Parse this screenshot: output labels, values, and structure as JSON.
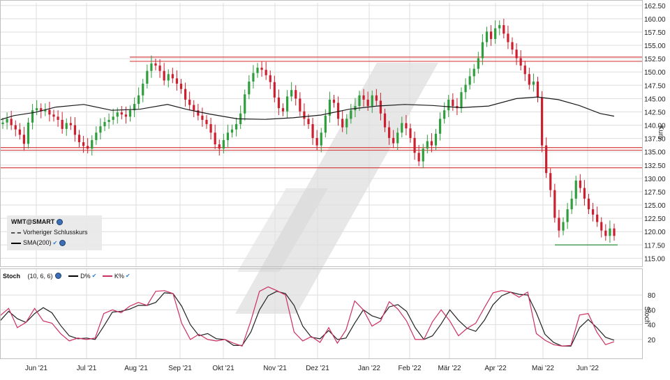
{
  "chart_data": [
    {
      "type": "candlestick",
      "title": "WMT@SMART",
      "ylabel": "Kurs",
      "ylim": [
        114,
        163
      ],
      "yticks": [
        "115.00",
        "117.50",
        "120.00",
        "122.50",
        "125.00",
        "127.50",
        "130.00",
        "132.50",
        "135.00",
        "137.50",
        "140.00",
        "142.50",
        "145.00",
        "147.50",
        "150.00",
        "152.50",
        "155.00",
        "157.50",
        "160.00",
        "162.50"
      ],
      "xticks": [
        "Jun '21",
        "Jul '21",
        "Aug '21",
        "Sep '21",
        "Okt '21",
        "Nov '21",
        "Dez '21",
        "Jan '22",
        "Feb '22",
        "Mär '22",
        "Apr '22",
        "Mai '22",
        "Jun '22"
      ],
      "legend": [
        {
          "label": "Vorheriger Schlusskurs",
          "style": "dashed"
        },
        {
          "label": "SMA(200)",
          "style": "solid"
        }
      ],
      "horizontal_levels": [
        {
          "value": 152.8,
          "color": "#d64545"
        },
        {
          "value": 152.0,
          "color": "#d64545"
        },
        {
          "value": 135.8,
          "color": "#d64545"
        },
        {
          "value": 135.3,
          "color": "#d64545"
        },
        {
          "value": 132.0,
          "color": "#d64545"
        },
        {
          "value": 117.5,
          "color": "#2e8b3e"
        }
      ],
      "close_series": [
        140.5,
        141.2,
        140.0,
        139.2,
        138.2,
        136.5,
        140.5,
        142.8,
        143.2,
        142.6,
        142.9,
        142.0,
        141.6,
        141.0,
        139.3,
        140.4,
        140.0,
        138.2,
        136.8,
        136.1,
        135.6,
        137.2,
        138.6,
        139.8,
        140.6,
        141.0,
        141.6,
        142.4,
        142.0,
        141.6,
        142.8,
        144.0,
        145.6,
        147.8,
        150.2,
        151.6,
        151.2,
        150.2,
        148.4,
        149.6,
        148.8,
        147.8,
        146.8,
        144.8,
        143.8,
        142.8,
        141.8,
        141.0,
        140.2,
        138.6,
        136.4,
        135.6,
        137.2,
        138.6,
        139.2,
        140.2,
        142.2,
        145.8,
        148.2,
        149.8,
        150.8,
        150.4,
        149.4,
        148.1,
        145.2,
        143.2,
        142.6,
        145.4,
        146.6,
        145.0,
        142.6,
        141.2,
        140.2,
        137.6,
        136.2,
        138.6,
        141.8,
        144.8,
        144.2,
        141.2,
        139.6,
        141.2,
        142.8,
        143.6,
        145.6,
        144.8,
        143.6,
        145.6,
        144.6,
        142.2,
        139.6,
        137.6,
        136.6,
        138.6,
        140.4,
        139.4,
        137.6,
        134.8,
        133.2,
        135.6,
        137.0,
        136.2,
        138.4,
        141.2,
        142.8,
        144.8,
        143.6,
        143.2,
        146.2,
        147.6,
        149.2,
        150.6,
        152.6,
        155.6,
        157.6,
        156.2,
        158.2,
        158.8,
        157.2,
        155.6,
        154.2,
        152.6,
        151.2,
        149.6,
        147.6,
        148.2,
        145.2,
        136.2,
        131.0,
        127.8,
        122.6,
        120.2,
        121.8,
        124.2,
        126.2,
        129.6,
        128.2,
        126.2,
        124.2,
        123.2,
        121.8,
        120.2,
        119.2,
        120.6,
        119.2
      ],
      "sma200": [
        [
          0,
          141.0
        ],
        [
          20,
          141.8
        ],
        [
          50,
          142.4
        ],
        [
          80,
          143.4
        ],
        [
          120,
          143.9
        ],
        [
          160,
          142.8
        ],
        [
          200,
          143.0
        ],
        [
          240,
          143.9
        ],
        [
          270,
          142.9
        ],
        [
          300,
          142.1
        ],
        [
          340,
          141.2
        ],
        [
          380,
          141.1
        ],
        [
          420,
          141.4
        ],
        [
          460,
          141.9
        ],
        [
          500,
          143.0
        ],
        [
          540,
          143.6
        ],
        [
          580,
          143.9
        ],
        [
          620,
          143.7
        ],
        [
          660,
          143.3
        ],
        [
          700,
          143.6
        ],
        [
          740,
          145.0
        ],
        [
          770,
          145.3
        ],
        [
          800,
          144.8
        ],
        [
          830,
          143.7
        ],
        [
          860,
          142.2
        ],
        [
          880,
          141.7
        ]
      ]
    },
    {
      "type": "line",
      "title": "Stoch",
      "params": "(10, 6, 6)",
      "ylabel": "Stoch",
      "ylim": [
        2,
        98
      ],
      "yticks": [
        "20",
        "40",
        "60",
        "80"
      ],
      "series": [
        {
          "name": "D%",
          "color": "#222222",
          "values": [
            45,
            58,
            48,
            43,
            55,
            63,
            56,
            39,
            25,
            21,
            22,
            20,
            38,
            57,
            58,
            61,
            66,
            66,
            70,
            83,
            82,
            65,
            40,
            25,
            28,
            21,
            20,
            12,
            12,
            30,
            60,
            79,
            85,
            82,
            66,
            38,
            23,
            21,
            32,
            20,
            22,
            42,
            60,
            52,
            48,
            64,
            67,
            58,
            36,
            20,
            25,
            41,
            60,
            46,
            35,
            31,
            46,
            67,
            79,
            84,
            81,
            80,
            56,
            27,
            16,
            11,
            11,
            36,
            47,
            36,
            23,
            19
          ]
        },
        {
          "name": "K%",
          "color": "#cc3060",
          "values": [
            52,
            62,
            36,
            43,
            62,
            45,
            42,
            28,
            18,
            22,
            20,
            22,
            55,
            60,
            56,
            65,
            70,
            66,
            85,
            86,
            82,
            42,
            20,
            27,
            20,
            18,
            20,
            15,
            11,
            45,
            85,
            91,
            86,
            80,
            30,
            18,
            24,
            16,
            36,
            15,
            33,
            72,
            60,
            38,
            45,
            71,
            61,
            45,
            20,
            20,
            44,
            60,
            45,
            25,
            35,
            42,
            63,
            83,
            86,
            84,
            77,
            84,
            28,
            19,
            13,
            11,
            12,
            53,
            55,
            30,
            13,
            17
          ]
        }
      ]
    }
  ],
  "legend_panel": {
    "symbol": "WMT@SMART",
    "items": [
      {
        "label": "Vorheriger Schlusskurs"
      },
      {
        "label": "SMA(200)"
      }
    ]
  },
  "stoch_header": {
    "name": "Stoch",
    "params": "(10, 6, 6)",
    "d_label": "D%",
    "k_label": "K%"
  },
  "colors": {
    "bull": "#2f9e3c",
    "bear": "#cc1f2f",
    "resistance": "#d64545",
    "support": "#2e8b3e",
    "sma": "#1a1a1a",
    "grid": "#dedede",
    "watermark": "#d3d3d3"
  }
}
